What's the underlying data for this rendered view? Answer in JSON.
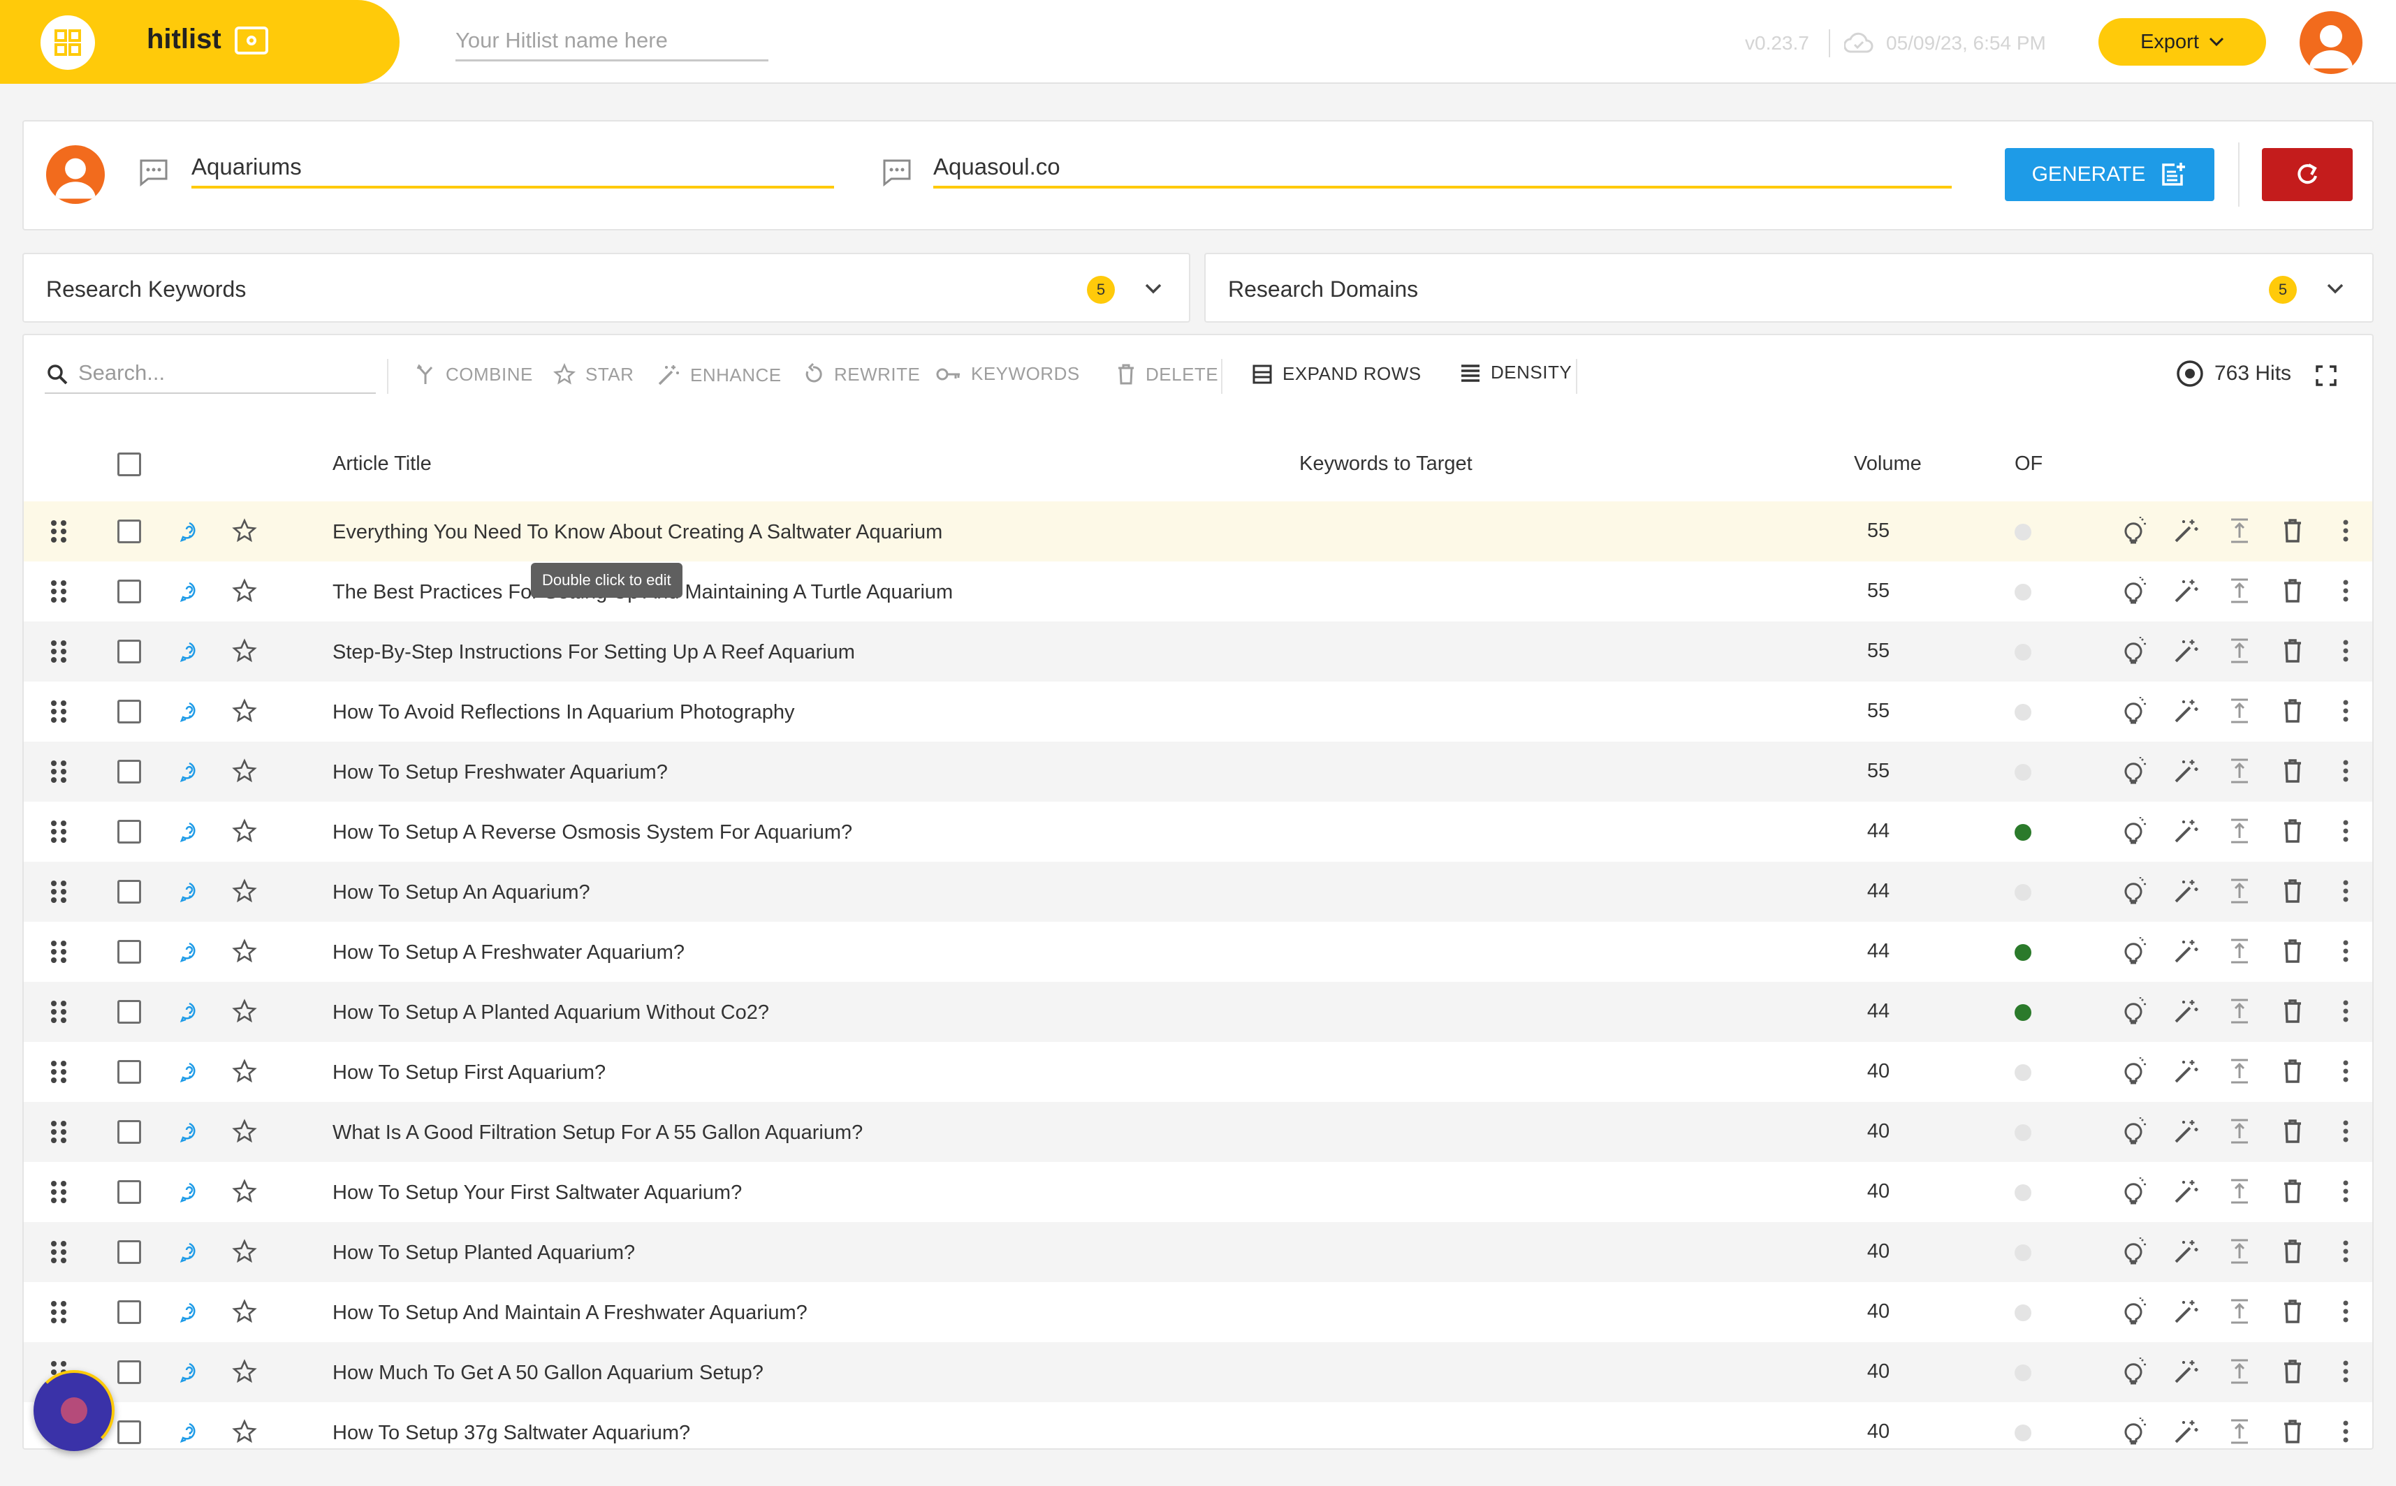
{
  "app": {
    "name": "hitlist",
    "hitlist_name_placeholder": "Your Hitlist name here",
    "version": "v0.23.7",
    "last_saved": "05/09/23, 6:54 PM",
    "export_label": "Export"
  },
  "generator": {
    "topic": "Aquariums",
    "domain": "Aquasoul.co",
    "generate_label": "GENERATE"
  },
  "research": {
    "keywords": {
      "title": "Research Keywords",
      "count": "5"
    },
    "domains": {
      "title": "Research Domains",
      "count": "5"
    }
  },
  "toolbar": {
    "search_placeholder": "Search...",
    "combine": "COMBINE",
    "star": "STAR",
    "enhance": "ENHANCE",
    "rewrite": "REWRITE",
    "keywords": "KEYWORDS",
    "delete": "DELETE",
    "expand_rows": "EXPAND ROWS",
    "density": "DENSITY",
    "hits": "763 Hits"
  },
  "columns": {
    "title": "Article Title",
    "keywords": "Keywords to Target",
    "volume": "Volume",
    "of": "OF"
  },
  "tooltip": "Double click to edit",
  "rows": [
    {
      "title": "Everything You Need To Know About Creating A Saltwater Aquarium",
      "volume": "55",
      "of": false
    },
    {
      "title": "The Best Practices For Setting Up And Maintaining A Turtle Aquarium",
      "volume": "55",
      "of": false
    },
    {
      "title": "Step-By-Step Instructions For Setting Up A Reef Aquarium",
      "volume": "55",
      "of": false
    },
    {
      "title": "How To Avoid Reflections In Aquarium Photography",
      "volume": "55",
      "of": false
    },
    {
      "title": "How To Setup Freshwater Aquarium?",
      "volume": "55",
      "of": false
    },
    {
      "title": "How To Setup A Reverse Osmosis System For Aquarium?",
      "volume": "44",
      "of": true
    },
    {
      "title": "How To Setup An Aquarium?",
      "volume": "44",
      "of": false
    },
    {
      "title": "How To Setup A Freshwater Aquarium?",
      "volume": "44",
      "of": true
    },
    {
      "title": "How To Setup A Planted Aquarium Without Co2?",
      "volume": "44",
      "of": true
    },
    {
      "title": "How To Setup First Aquarium?",
      "volume": "40",
      "of": false
    },
    {
      "title": "What Is A Good Filtration Setup For A 55 Gallon Aquarium?",
      "volume": "40",
      "of": false
    },
    {
      "title": "How To Setup Your First Saltwater Aquarium?",
      "volume": "40",
      "of": false
    },
    {
      "title": "How To Setup Planted Aquarium?",
      "volume": "40",
      "of": false
    },
    {
      "title": "How To Setup And Maintain A Freshwater Aquarium?",
      "volume": "40",
      "of": false
    },
    {
      "title": "How Much To Get A 50 Gallon Aquarium Setup?",
      "volume": "40",
      "of": false
    },
    {
      "title": "How To Setup 37g Saltwater Aquarium?",
      "volume": "40",
      "of": false
    }
  ],
  "colors": {
    "brand": "#ffca0a",
    "generate": "#1e9be7",
    "reset": "#c41c1c",
    "of_on": "#2b7a2b",
    "of_off": "#e4e4e4"
  }
}
